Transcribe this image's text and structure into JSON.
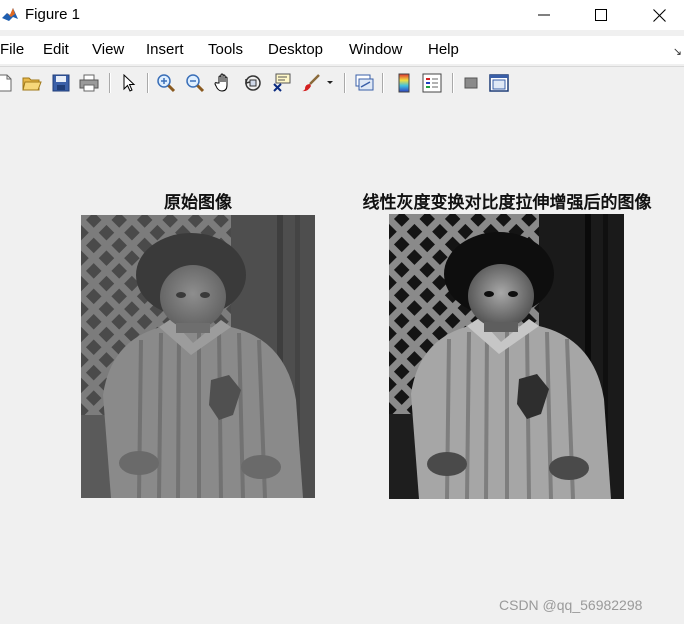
{
  "window": {
    "title": "Figure 1",
    "controls": {
      "minimize": "minimize",
      "maximize": "maximize",
      "close": "close"
    }
  },
  "menu": {
    "items": [
      "File",
      "Edit",
      "View",
      "Insert",
      "Tools",
      "Desktop",
      "Window",
      "Help"
    ]
  },
  "toolbar": {
    "icons": [
      "new-figure-icon",
      "open-file-icon",
      "save-icon",
      "print-icon",
      "pointer-icon",
      "zoom-in-icon",
      "zoom-out-icon",
      "pan-hand-icon",
      "rotate-3d-icon",
      "data-cursor-icon",
      "brush-icon",
      "brush-dropdown-icon",
      "link-plot-icon",
      "colorbar-icon",
      "legend-icon",
      "hide-plot-tools-icon",
      "show-plot-tools-icon"
    ]
  },
  "figure": {
    "left_title": "原始图像",
    "right_title": "线性灰度变换对比度拉伸增强后的图像",
    "watermark": "CSDN @qq_56982298"
  },
  "colors": {
    "matlab_orange": "#e06820",
    "matlab_blue": "#1f5fb0",
    "figure_bg": "#f0f0f0"
  }
}
